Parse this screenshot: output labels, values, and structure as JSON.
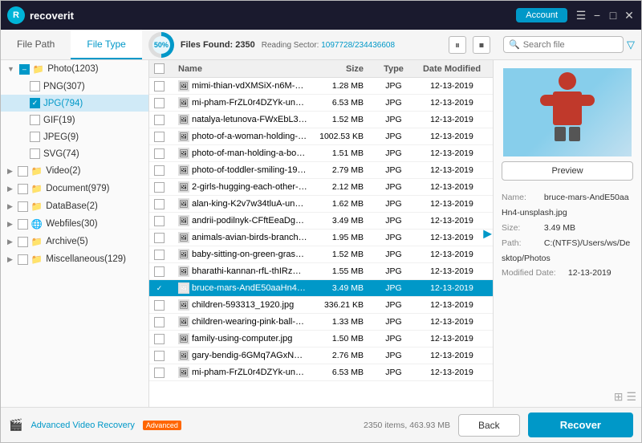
{
  "titleBar": {
    "appName": "recoverit",
    "accountLabel": "Account",
    "icons": [
      "menu",
      "minimize",
      "maximize",
      "close"
    ]
  },
  "tabs": [
    {
      "id": "filepath",
      "label": "File Path",
      "active": false
    },
    {
      "id": "filetype",
      "label": "File Type",
      "active": true
    }
  ],
  "scanBar": {
    "progress": "50%",
    "filesFound": "Files Found: 2350",
    "readingSector": "Reading Sector:",
    "sectorNum": "1097728/234436608",
    "pauseIcon": "⏸",
    "stopIcon": "⏹"
  },
  "searchBar": {
    "placeholder": "Search file",
    "filterIcon": "▽"
  },
  "sidebar": {
    "items": [
      {
        "id": "photo",
        "label": "Photo(1203)",
        "level": 0,
        "expanded": true,
        "checked": "partial",
        "icon": "📁"
      },
      {
        "id": "png",
        "label": "PNG(307)",
        "level": 1,
        "checked": false,
        "icon": "🖼"
      },
      {
        "id": "jpg",
        "label": "JPG(794)",
        "level": 1,
        "checked": true,
        "selected": true,
        "icon": "🖼"
      },
      {
        "id": "gif",
        "label": "GIF(19)",
        "level": 1,
        "checked": false,
        "icon": "🖼"
      },
      {
        "id": "jpeg",
        "label": "JPEG(9)",
        "level": 1,
        "checked": false,
        "icon": "🖼"
      },
      {
        "id": "svg",
        "label": "SVG(74)",
        "level": 1,
        "checked": false,
        "icon": "🖼"
      },
      {
        "id": "video",
        "label": "Video(2)",
        "level": 0,
        "expanded": false,
        "checked": false,
        "icon": "📁"
      },
      {
        "id": "document",
        "label": "Document(979)",
        "level": 0,
        "expanded": false,
        "checked": false,
        "icon": "📁"
      },
      {
        "id": "database",
        "label": "DataBase(2)",
        "level": 0,
        "expanded": false,
        "checked": false,
        "icon": "📁"
      },
      {
        "id": "webfiles",
        "label": "Webfiles(30)",
        "level": 0,
        "expanded": false,
        "checked": false,
        "icon": "🌐"
      },
      {
        "id": "archive",
        "label": "Archive(5)",
        "level": 0,
        "expanded": false,
        "checked": false,
        "icon": "📁"
      },
      {
        "id": "misc",
        "label": "Miscellaneous(129)",
        "level": 0,
        "expanded": false,
        "checked": false,
        "icon": "📁"
      }
    ]
  },
  "fileList": {
    "columns": [
      {
        "id": "name",
        "label": "Name"
      },
      {
        "id": "size",
        "label": "Size"
      },
      {
        "id": "type",
        "label": "Type"
      },
      {
        "id": "date",
        "label": "Date Modified"
      }
    ],
    "files": [
      {
        "name": "mimi-thian-vdXMSiX-n6M-unsplash.jpg",
        "size": "1.28 MB",
        "type": "JPG",
        "date": "12-13-2019",
        "selected": false
      },
      {
        "name": "mi-pham-FrZL0r4DZYk-unsplash.jpg",
        "size": "6.53 MB",
        "type": "JPG",
        "date": "12-13-2019",
        "selected": false
      },
      {
        "name": "natalya-letunova-FWxEbL34i4Y-unspl...",
        "size": "1.52 MB",
        "type": "JPG",
        "date": "12-13-2019",
        "selected": false
      },
      {
        "name": "photo-of-a-woman-holding-an-ipad-7...",
        "size": "1002.53 KB",
        "type": "JPG",
        "date": "12-13-2019",
        "selected": false
      },
      {
        "name": "photo-of-man-holding-a-book-92702...",
        "size": "1.51 MB",
        "type": "JPG",
        "date": "12-13-2019",
        "selected": false
      },
      {
        "name": "photo-of-toddler-smiling-1912868.jpg",
        "size": "2.79 MB",
        "type": "JPG",
        "date": "12-13-2019",
        "selected": false
      },
      {
        "name": "2-girls-hugging-each-other-outdoor-...",
        "size": "2.12 MB",
        "type": "JPG",
        "date": "12-13-2019",
        "selected": false
      },
      {
        "name": "alan-king-K2v7w34tluA-unsplash.jpg",
        "size": "1.62 MB",
        "type": "JPG",
        "date": "12-13-2019",
        "selected": false
      },
      {
        "name": "andrii-podilnyk-CFftEeaDg1I-unsplash...",
        "size": "3.49 MB",
        "type": "JPG",
        "date": "12-13-2019",
        "selected": false
      },
      {
        "name": "animals-avian-birds-branch-459326.jpg...",
        "size": "1.95 MB",
        "type": "JPG",
        "date": "12-13-2019",
        "selected": false
      },
      {
        "name": "baby-sitting-on-green-grass-beside-...",
        "size": "1.52 MB",
        "type": "JPG",
        "date": "12-13-2019",
        "selected": false
      },
      {
        "name": "bharathi-kannan-rfL-thIRzDs-unsplash...",
        "size": "1.55 MB",
        "type": "JPG",
        "date": "12-13-2019",
        "selected": false
      },
      {
        "name": "bruce-mars-AndE50aaHn4-unsplash...",
        "size": "3.49 MB",
        "type": "JPG",
        "date": "12-13-2019",
        "selected": true
      },
      {
        "name": "children-593313_1920.jpg",
        "size": "336.21 KB",
        "type": "JPG",
        "date": "12-13-2019",
        "selected": false
      },
      {
        "name": "children-wearing-pink-ball-dress-360...",
        "size": "1.33 MB",
        "type": "JPG",
        "date": "12-13-2019",
        "selected": false
      },
      {
        "name": "family-using-computer.jpg",
        "size": "1.50 MB",
        "type": "JPG",
        "date": "12-13-2019",
        "selected": false
      },
      {
        "name": "gary-bendig-6GMq7AGxNbE-unsplash...",
        "size": "2.76 MB",
        "type": "JPG",
        "date": "12-13-2019",
        "selected": false
      },
      {
        "name": "mi-pham-FrZL0r4DZYk-unsplash.jpg",
        "size": "6.53 MB",
        "type": "JPG",
        "date": "12-13-2019",
        "selected": false
      }
    ],
    "statusText": "2350 items, 463.93 MB"
  },
  "previewPanel": {
    "previewBtnLabel": "Preview",
    "metaName": "bruce-mars-AndE50aaHn4-unsplash.jpg",
    "metaSize": "3.49 MB",
    "metaPath": "C:(NTFS)/Users/ws/Desktop/Photos",
    "metaModDate": "12-13-2019"
  },
  "bottomBar": {
    "advVideoLabel": "Advanced Video Recovery",
    "advBadge": "Advanced",
    "backLabel": "Back",
    "recoverLabel": "Recover"
  }
}
